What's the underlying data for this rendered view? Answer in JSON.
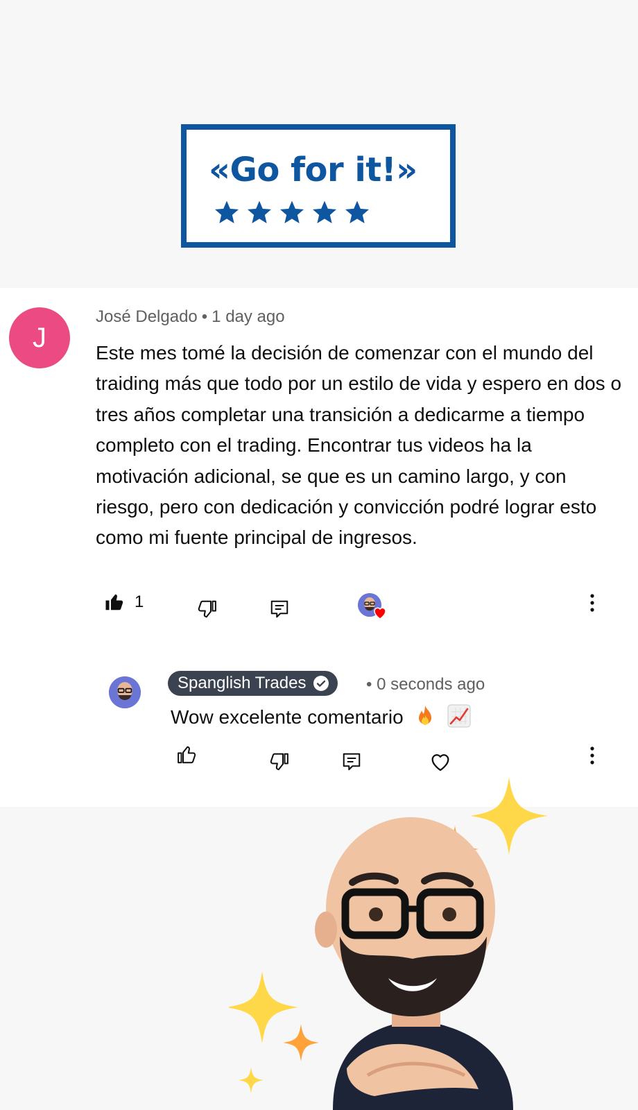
{
  "sticker": {
    "text": "«Go for it!»",
    "stars": 5,
    "color": "#0e57a0"
  },
  "comment": {
    "avatar_letter": "J",
    "avatar_color": "#ec4a82",
    "author": "José Delgado",
    "time": "1 day ago",
    "text": "Este mes tomé la decisión de comenzar con el mundo del traiding más que todo por un estilo de vida y espero en dos o tres años completar una transición a dedicarme a tiempo completo con el trading. Encontrar tus videos ha la motivación adicional, se que es un camino largo, y con riesgo, pero con dedicación y convicción podré lograr esto como mi fuente principal de ingresos.",
    "like_count": "1",
    "icons": [
      "thumbs-up-filled-icon",
      "thumbs-down-icon",
      "reply-icon",
      "creator-heart-icon",
      "more-vert-icon"
    ]
  },
  "reply": {
    "channel": "Spanglish Trades",
    "verified": true,
    "time": "0 seconds ago",
    "text": "Wow excelente comentario",
    "emojis": [
      "fire-emoji",
      "chart-increasing-emoji"
    ],
    "icons": [
      "thumbs-up-icon",
      "thumbs-down-icon",
      "reply-icon",
      "heart-icon",
      "more-vert-icon"
    ]
  }
}
